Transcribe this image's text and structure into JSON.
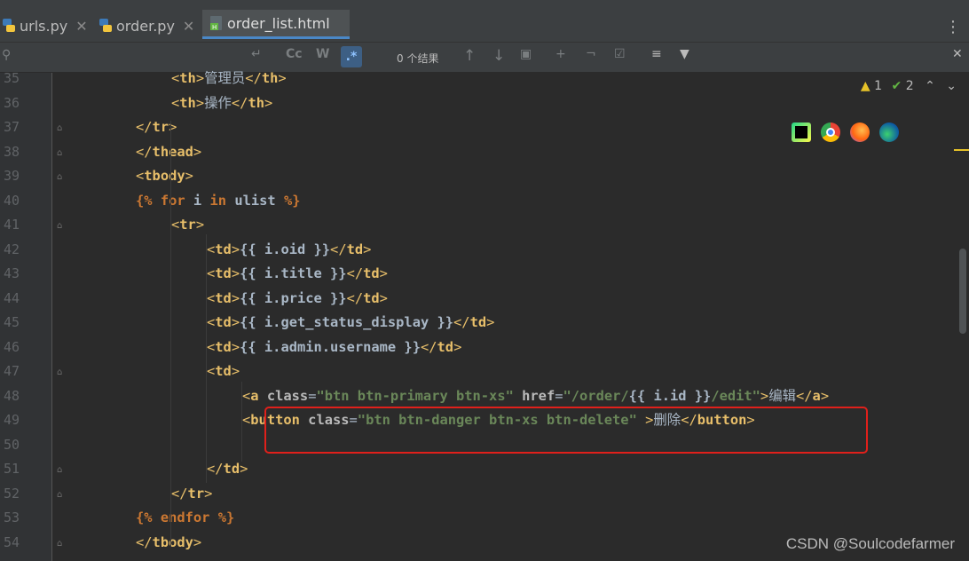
{
  "tabs": [
    {
      "label": "urls.py",
      "icon": "python-file-icon",
      "active": false
    },
    {
      "label": "order.py",
      "icon": "python-file-icon",
      "active": false
    },
    {
      "label": "order_list.html",
      "icon": "html-file-icon",
      "active": true
    }
  ],
  "findbar": {
    "results": "0 个结果",
    "match_case": "Cc",
    "words": "W",
    "regex": ".*"
  },
  "inspections": {
    "warnings": "1",
    "ok": "2"
  },
  "browser_icons": [
    "pycharm-icon",
    "chrome-icon",
    "firefox-icon",
    "edge-icon"
  ],
  "lines": [
    {
      "num": "35",
      "text": "<th>管理员</th>"
    },
    {
      "num": "36",
      "text": "<th>操作</th>"
    },
    {
      "num": "37",
      "text": "</tr>"
    },
    {
      "num": "38",
      "text": "</thead>"
    },
    {
      "num": "39",
      "text": "<tbody>"
    },
    {
      "num": "40",
      "text": "{% for i in ulist %}"
    },
    {
      "num": "41",
      "text": "<tr>"
    },
    {
      "num": "42",
      "text": "<td>{{ i.oid }}</td>"
    },
    {
      "num": "43",
      "text": "<td>{{ i.title }}</td>"
    },
    {
      "num": "44",
      "text": "<td>{{ i.price }}</td>"
    },
    {
      "num": "45",
      "text": "<td>{{ i.get_status_display }}</td>"
    },
    {
      "num": "46",
      "text": "<td>{{ i.admin.username }}</td>"
    },
    {
      "num": "47",
      "text": "<td>"
    },
    {
      "num": "48",
      "text": "<a class=\"btn btn-primary btn-xs\" href=\"/order/{{ i.id }}/edit\">编辑</a>"
    },
    {
      "num": "49",
      "text": "<button class=\"btn btn-danger btn-xs btn-delete\" >删除</button>"
    },
    {
      "num": "50",
      "text": ""
    },
    {
      "num": "51",
      "text": "</td>"
    },
    {
      "num": "52",
      "text": "</tr>"
    },
    {
      "num": "53",
      "text": "{% endfor %}"
    },
    {
      "num": "54",
      "text": "</tbody>"
    }
  ],
  "watermark": "CSDN @Soulcodefarmer",
  "colors": {
    "accent": "#4a88c7",
    "highlight_box": "#e0201b",
    "tag": "#e8bf6a",
    "string": "#6a8759",
    "keyword": "#cc7832"
  }
}
